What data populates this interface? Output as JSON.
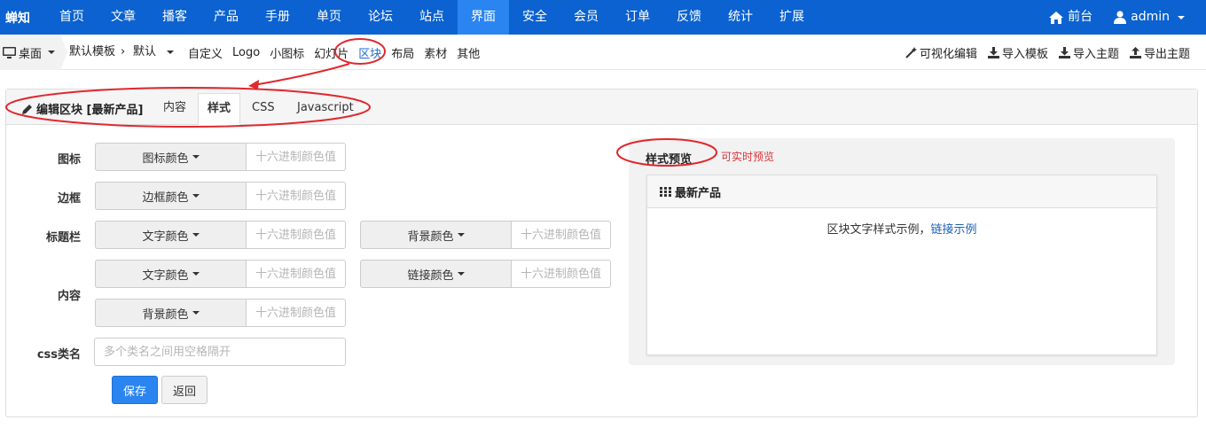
{
  "brand": "蝉知",
  "nav": {
    "items": [
      "首页",
      "文章",
      "播客",
      "产品",
      "手册",
      "单页",
      "论坛",
      "站点",
      "界面",
      "安全",
      "会员",
      "订单",
      "反馈",
      "统计",
      "扩展"
    ],
    "active_index": 8,
    "right": {
      "front": "前台",
      "user": "admin"
    }
  },
  "subbar": {
    "desktop": "桌面",
    "crumb_template": "默认模板",
    "crumb_theme": "默认",
    "links": [
      "自定义",
      "Logo",
      "小图标",
      "幻灯片",
      "区块",
      "布局",
      "素材",
      "其他"
    ],
    "active_link_index": 4,
    "actions": [
      "可视化编辑",
      "导入模板",
      "导入主题",
      "导出主题"
    ]
  },
  "panel": {
    "title": "编辑区块 [最新产品]",
    "tabs": [
      "内容",
      "样式",
      "CSS",
      "Javascript"
    ],
    "active_tab": 1
  },
  "form": {
    "labels": {
      "icon": "图标",
      "border": "边框",
      "titlebar": "标题栏",
      "content": "内容",
      "css": "css类名"
    },
    "buttons": {
      "icon_color": "图标颜色",
      "border_color": "边框颜色",
      "text_color": "文字颜色",
      "bg_color": "背景颜色",
      "link_color": "链接颜色"
    },
    "hex_placeholder": "十六进制颜色值",
    "css_placeholder": "多个类名之间用空格隔开",
    "save": "保存",
    "back": "返回"
  },
  "preview": {
    "title": "样式预览",
    "hint": "可实时预览",
    "block_title": "最新产品",
    "sample_text": "区块文字样式示例，",
    "sample_link": "链接示例"
  },
  "colors": {
    "nav_bg": "#0b62d0",
    "nav_active": "#2b85f0",
    "annotation": "#e0282e",
    "link": "#1a5fb4"
  }
}
